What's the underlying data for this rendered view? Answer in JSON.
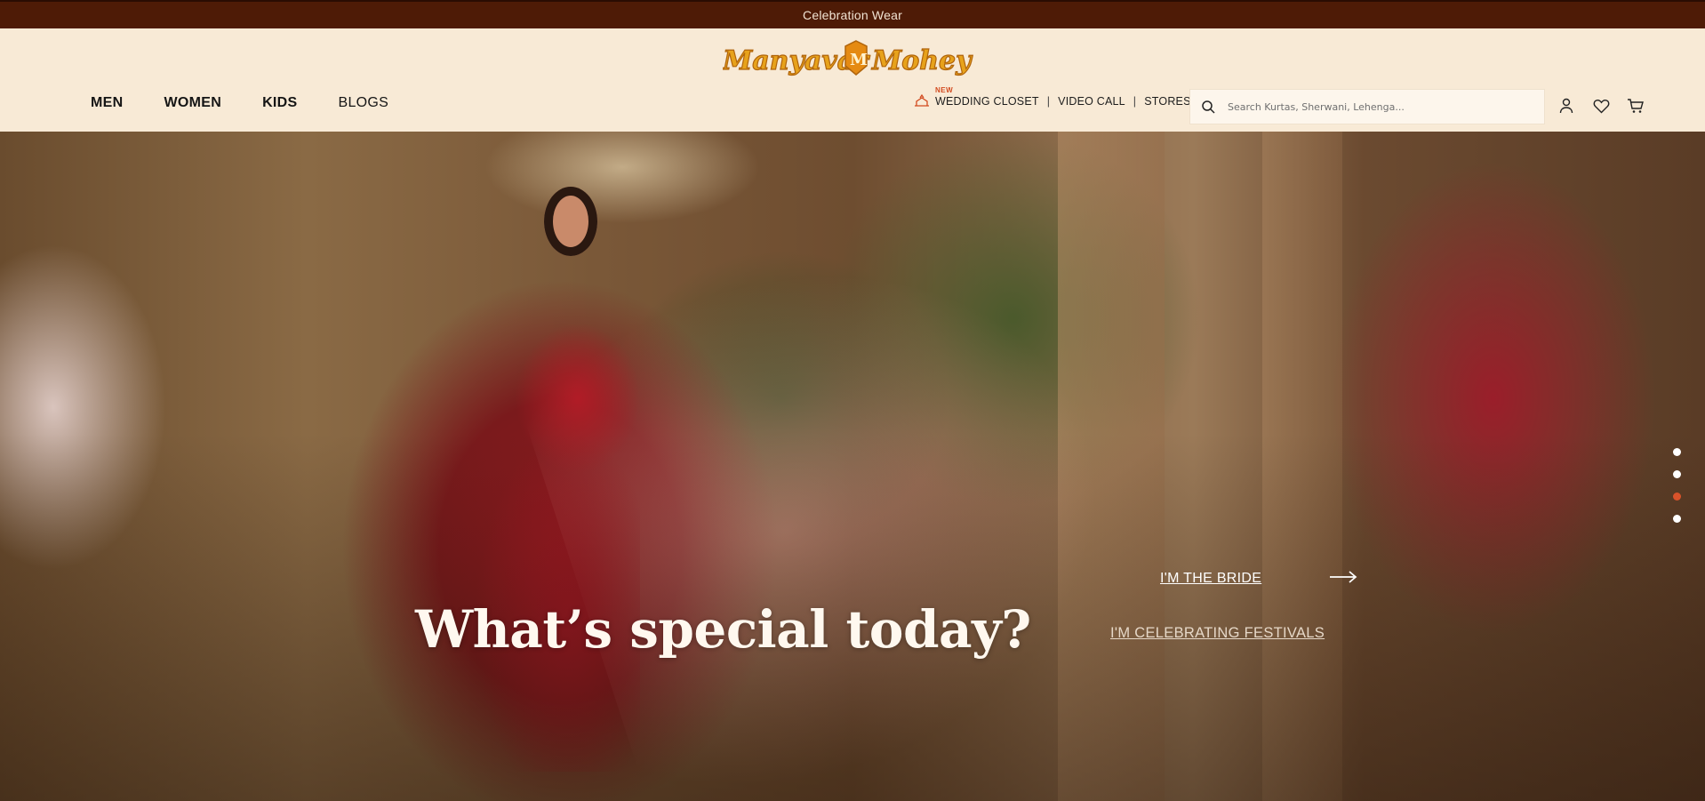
{
  "announcement": {
    "text": "Celebration Wear"
  },
  "brand": {
    "name": "Manyavar Mohey"
  },
  "nav": {
    "items": [
      {
        "label": "MEN"
      },
      {
        "label": "WOMEN"
      },
      {
        "label": "KIDS"
      },
      {
        "label": "BLOGS"
      }
    ]
  },
  "quick_links": {
    "new_badge": "NEW",
    "wedding_closet": "WEDDING CLOSET",
    "video_call": "VIDEO CALL",
    "stores": "STORES",
    "separator": "|"
  },
  "search": {
    "placeholder": "Search Kurtas, Sherwani, Lehenga..."
  },
  "header_icons": [
    "user-icon",
    "heart-icon",
    "cart-icon"
  ],
  "hero": {
    "headline": "What’s special today?",
    "option_primary": "I'M THE BRIDE",
    "option_secondary": "I'M CELEBRATING FESTIVALS",
    "slide_count": 4,
    "active_slide": 3
  },
  "colors": {
    "announcement_bg": "#4e1b06",
    "header_bg": "#f8ead6",
    "accent": "#d9522a",
    "logo_gold": "#e7a21b"
  }
}
